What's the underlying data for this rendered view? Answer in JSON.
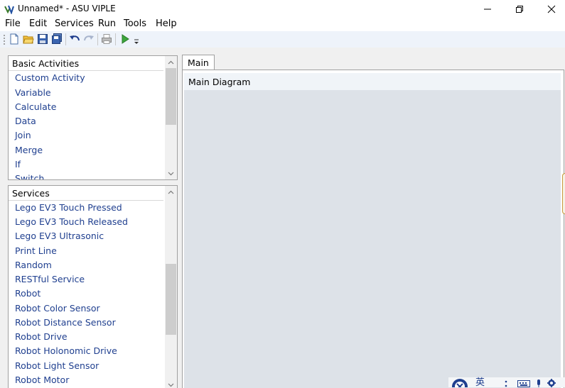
{
  "window": {
    "title": "Unnamed* - ASU VIPLE"
  },
  "menu": [
    "File",
    "Edit",
    "Services",
    "Run",
    "Tools",
    "Help"
  ],
  "toolbar": {
    "icons": [
      "new-file-icon",
      "open-folder-icon",
      "save-icon",
      "save-all-icon",
      "undo-icon",
      "redo-icon",
      "print-icon",
      "run-icon"
    ]
  },
  "basic_activities": {
    "header": "Basic Activities",
    "items": [
      "Custom Activity",
      "Variable",
      "Calculate",
      "Data",
      "Join",
      "Merge",
      "If",
      "Switch"
    ]
  },
  "services": {
    "header": "Services",
    "items": [
      "Lego EV3 Touch Pressed",
      "Lego EV3 Touch Released",
      "Lego EV3 Ultrasonic",
      "Print Line",
      "Random",
      "RESTful Service",
      "Robot",
      "Robot Color Sensor",
      "Robot Distance Sensor",
      "Robot Drive",
      "Robot Holonomic Drive",
      "Robot Light Sensor",
      "Robot Motor"
    ]
  },
  "tabs": [
    {
      "label": "Main",
      "active": true
    }
  ],
  "diagram": {
    "title": "Main Diagram"
  },
  "tray": {
    "ime_label": "英"
  },
  "colors": {
    "accent": "#1f3f8f",
    "canvas": "#dde2e8",
    "toolbar": "#eef3fa"
  }
}
